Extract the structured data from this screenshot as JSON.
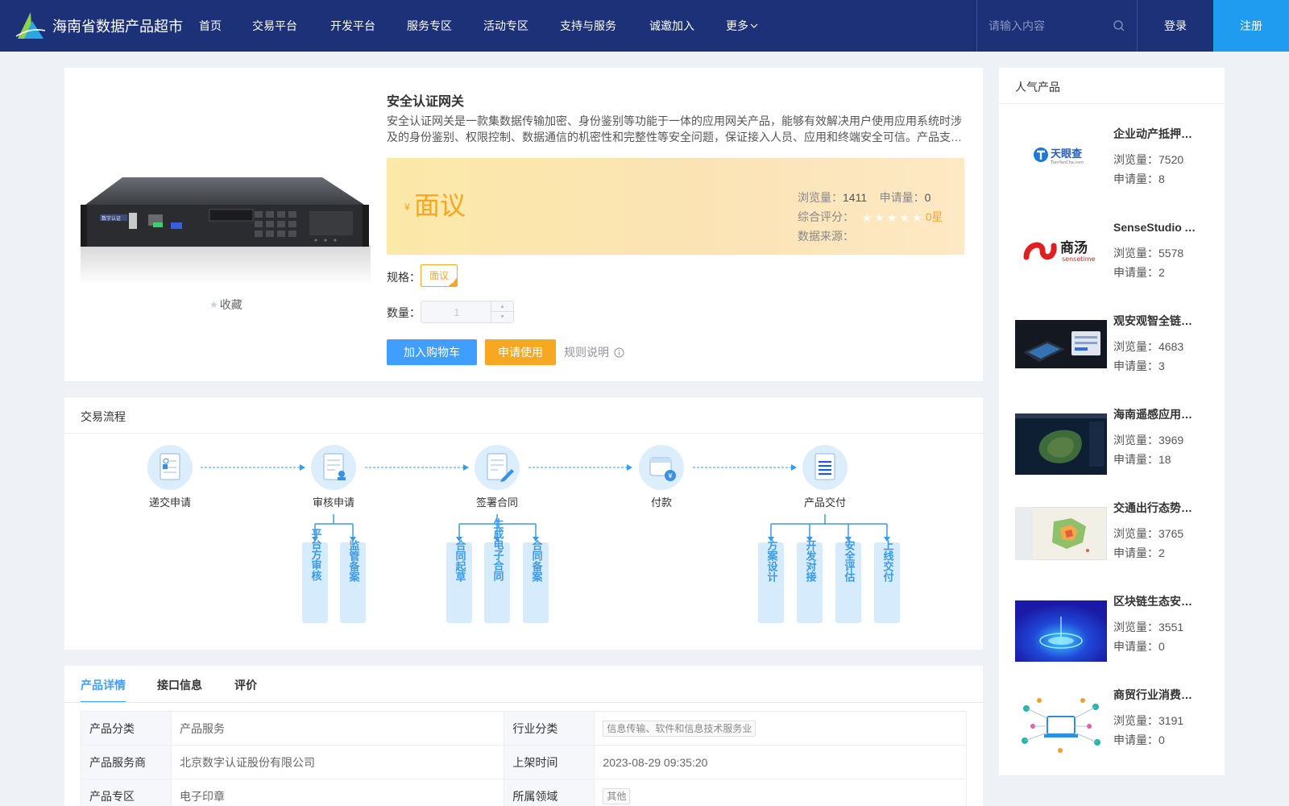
{
  "nav": {
    "site_name": "海南省数据产品超市",
    "items": [
      "首页",
      "交易平台",
      "开发平台",
      "服务专区",
      "活动专区",
      "支持与服务",
      "诚邀加入"
    ],
    "more_label": "更多",
    "search_placeholder": "请输入内容",
    "login_label": "登录",
    "register_label": "注册"
  },
  "product": {
    "title": "安全认证网关",
    "description": "安全认证网关是一款集数据传输加密、身份鉴别等功能于一体的应用网关产品，能够有效解决用户使用应用系统时涉及的身份鉴别、权限控制、数据通信的机密性和完整性等安全问题，保证接入人员、应用和终端安全可信。产品支持多种认证方式。",
    "image_label": "数字认证",
    "currency": "¥",
    "price": "面议",
    "views_label": "浏览量：",
    "views": "1411",
    "applies_label": "申请量：",
    "applies": "0",
    "rating_label": "综合评分：",
    "rating_value": "0星",
    "source_label": "数据来源：",
    "source": "",
    "favorite_label": "收藏",
    "spec_label": "规格：",
    "spec_option": "面议",
    "qty_label": "数量：",
    "qty_value": "1",
    "cart_label": "加入购物车",
    "apply_label": "申请使用",
    "rules_label": "规则说明"
  },
  "flow": {
    "title": "交易流程",
    "steps": [
      "递交申请",
      "审核申请",
      "签署合同",
      "付款",
      "产品交付"
    ],
    "sub_review": [
      "平台方审核",
      "监管备案"
    ],
    "sub_contract": [
      "合同起草",
      "生成电子合同",
      "合同备案"
    ],
    "sub_delivery": [
      "方案设计",
      "开发对接",
      "安全评估",
      "上线交付"
    ]
  },
  "tabs": [
    "产品详情",
    "接口信息",
    "评价"
  ],
  "details": {
    "category_label": "产品分类",
    "category": "产品服务",
    "industry_label": "行业分类",
    "industry": "信息传输、软件和信息技术服务业",
    "provider_label": "产品服务商",
    "provider": "北京数字认证股份有限公司",
    "listed_label": "上架时间",
    "listed": "2023-08-29 09:35:20",
    "zone_label": "产品专区",
    "zone": "电子印章",
    "domain_label": "所属领域",
    "domain": "其他"
  },
  "sidebar": {
    "title": "人气产品",
    "views_label": "浏览量：",
    "applies_label": "申请量：",
    "items": [
      {
        "name": "企业动产抵押信息查询",
        "views": "7520",
        "applies": "8",
        "thumb_text": "天眼查",
        "thumb_sub": "TianYanCha.com"
      },
      {
        "name": "SenseStudio AI开发平台",
        "views": "5578",
        "applies": "2",
        "thumb_text": "商汤",
        "thumb_sub": "sensetime"
      },
      {
        "name": "观安观智全链路数据安全平台",
        "views": "4683",
        "applies": "3"
      },
      {
        "name": "海南遥感应用服务平台",
        "views": "3969",
        "applies": "18"
      },
      {
        "name": "交通出行态势分析",
        "views": "3765",
        "applies": "2"
      },
      {
        "name": "区块链生态安全服务",
        "views": "3551",
        "applies": "0"
      },
      {
        "name": "商贸行业消费数据分析",
        "views": "3191",
        "applies": "0"
      }
    ]
  },
  "colors": {
    "nav_bg": "#1c3178",
    "primary": "#409eff",
    "register_bg": "#1f9cf0",
    "accent_orange": "#f6a823"
  },
  "icons": [
    "logo-icon",
    "search-icon",
    "chevron-down-icon",
    "star-icon",
    "info-icon",
    "document-icon",
    "stamp-icon",
    "contract-pen-icon",
    "wallet-icon",
    "list-icon"
  ]
}
